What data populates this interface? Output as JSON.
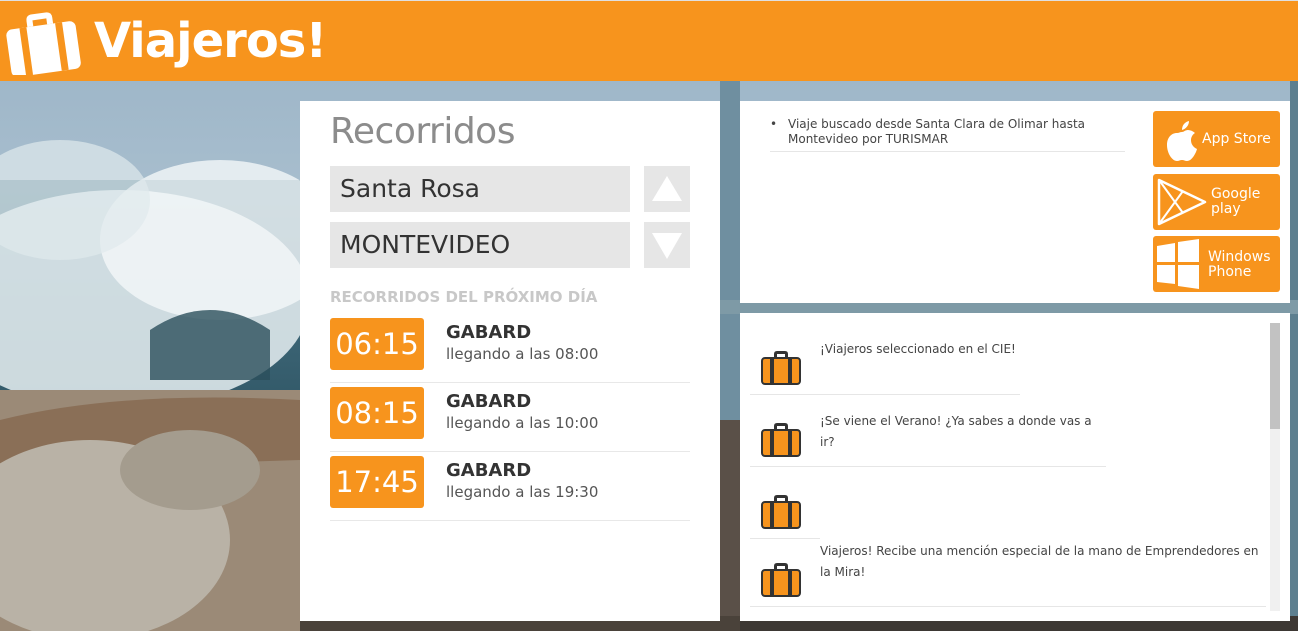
{
  "header": {
    "brand": "Viajeros!",
    "color": "#f7941d"
  },
  "routes": {
    "title": "Recorridos",
    "origin": "Santa Rosa",
    "destination": "MONTEVIDEO",
    "section_label": "RECORRIDOS DEL PRÓXIMO DÍA",
    "trips": [
      {
        "time": "06:15",
        "company": "GABARD",
        "arrival": "llegando a las 08:00"
      },
      {
        "time": "08:15",
        "company": "GABARD",
        "arrival": "llegando a las 10:00"
      },
      {
        "time": "17:45",
        "company": "GABARD",
        "arrival": "llegando a las 19:30"
      }
    ]
  },
  "searches": {
    "items": [
      "Viaje buscado desde Santa Clara de Olimar hasta Montevideo por TURISMAR"
    ]
  },
  "stores": {
    "app_store": "App Store",
    "google_play_line1": "Google",
    "google_play_line2": "play",
    "windows_line1": "Windows",
    "windows_line2": "Phone"
  },
  "news": {
    "items": [
      {
        "text": "¡Viajeros seleccionado en el CIE!",
        "icon": "suitcase-icon"
      },
      {
        "text": "¡Se viene el Verano! ¿Ya sabes a donde vas a ir?",
        "icon": "suitcase-icon"
      },
      {
        "text": "",
        "icon": "suitcase-icon"
      },
      {
        "text": "Viajeros! Recibe una mención especial de la mano de Emprendedores en la Mira!",
        "icon": "suitcase-icon"
      }
    ]
  },
  "colors": {
    "accent": "#f7941d",
    "panel_bg": "#ffffff",
    "input_bg": "#e6e6e6"
  }
}
